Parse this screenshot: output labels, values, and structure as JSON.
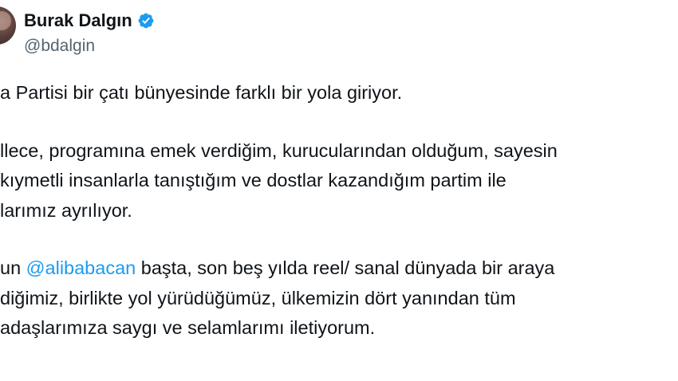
{
  "author": {
    "display_name": "Burak Dalgın",
    "handle": "@bdalgin",
    "verified_icon": "verified-badge-icon",
    "verified_color": "#1d9bf0"
  },
  "tweet": {
    "paragraph_1": {
      "line_1": "a Partisi bir çatı bünyesinde farklı bir yola giriyor."
    },
    "paragraph_2": {
      "line_1": "llece, programına emek verdiğim, kurucularından olduğum, sayesin",
      "line_2": " kıymetli insanlarla tanıştığım ve dostlar kazandığım partim ile",
      "line_3": "larımız ayrılıyor."
    },
    "paragraph_3": {
      "line_1_prefix": "un ",
      "mention": "@alibabacan",
      "line_1_suffix": " başta, son beş yılda reel/ sanal dünyada bir araya",
      "line_2": "diğimiz, birlikte yol yürüdüğümüz, ülkemizin dört yanından tüm",
      "line_3": "adaşlarımıza saygı ve selamlarımı iletiyorum."
    }
  },
  "colors": {
    "text": "#0f1419",
    "secondary": "#536471",
    "link": "#1d9bf0"
  }
}
